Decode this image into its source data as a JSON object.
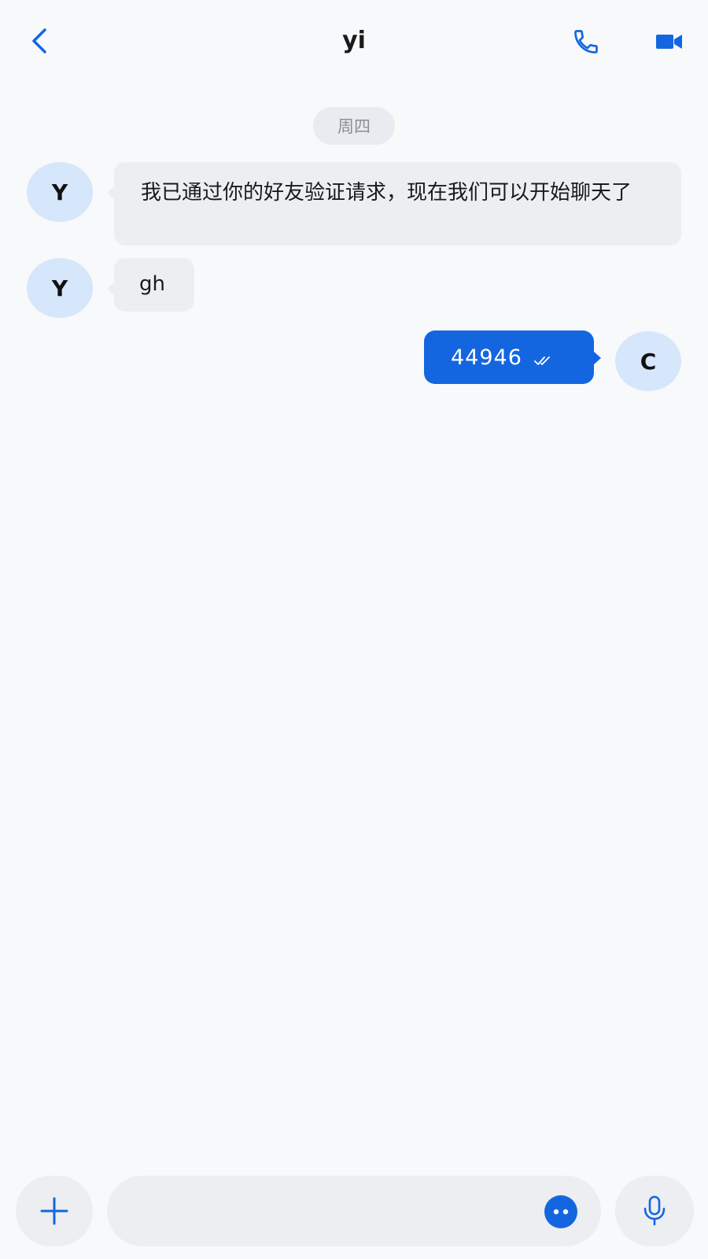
{
  "header": {
    "title": "yi",
    "back_icon": "chevron-left-icon",
    "call_icon": "phone-icon",
    "video_icon": "video-camera-icon"
  },
  "date_separator": "周四",
  "messages": [
    {
      "direction": "incoming",
      "avatar_initial": "Y",
      "text": "我已通过你的好友验证请求，现在我们可以开始聊天了"
    },
    {
      "direction": "incoming",
      "avatar_initial": "Y",
      "text": "gh"
    },
    {
      "direction": "outgoing",
      "avatar_initial": "C",
      "text": "44946",
      "status_icon": "double-check-icon"
    }
  ],
  "composer": {
    "value": "",
    "placeholder": "",
    "plus_icon": "plus-icon",
    "emoji_icon": "emoji-icon",
    "mic_icon": "microphone-icon"
  },
  "colors": {
    "accent": "#1466e0",
    "background": "#f8f9fb",
    "avatar_bg": "#d6e6fb",
    "incoming_bubble": "#eceef2"
  }
}
